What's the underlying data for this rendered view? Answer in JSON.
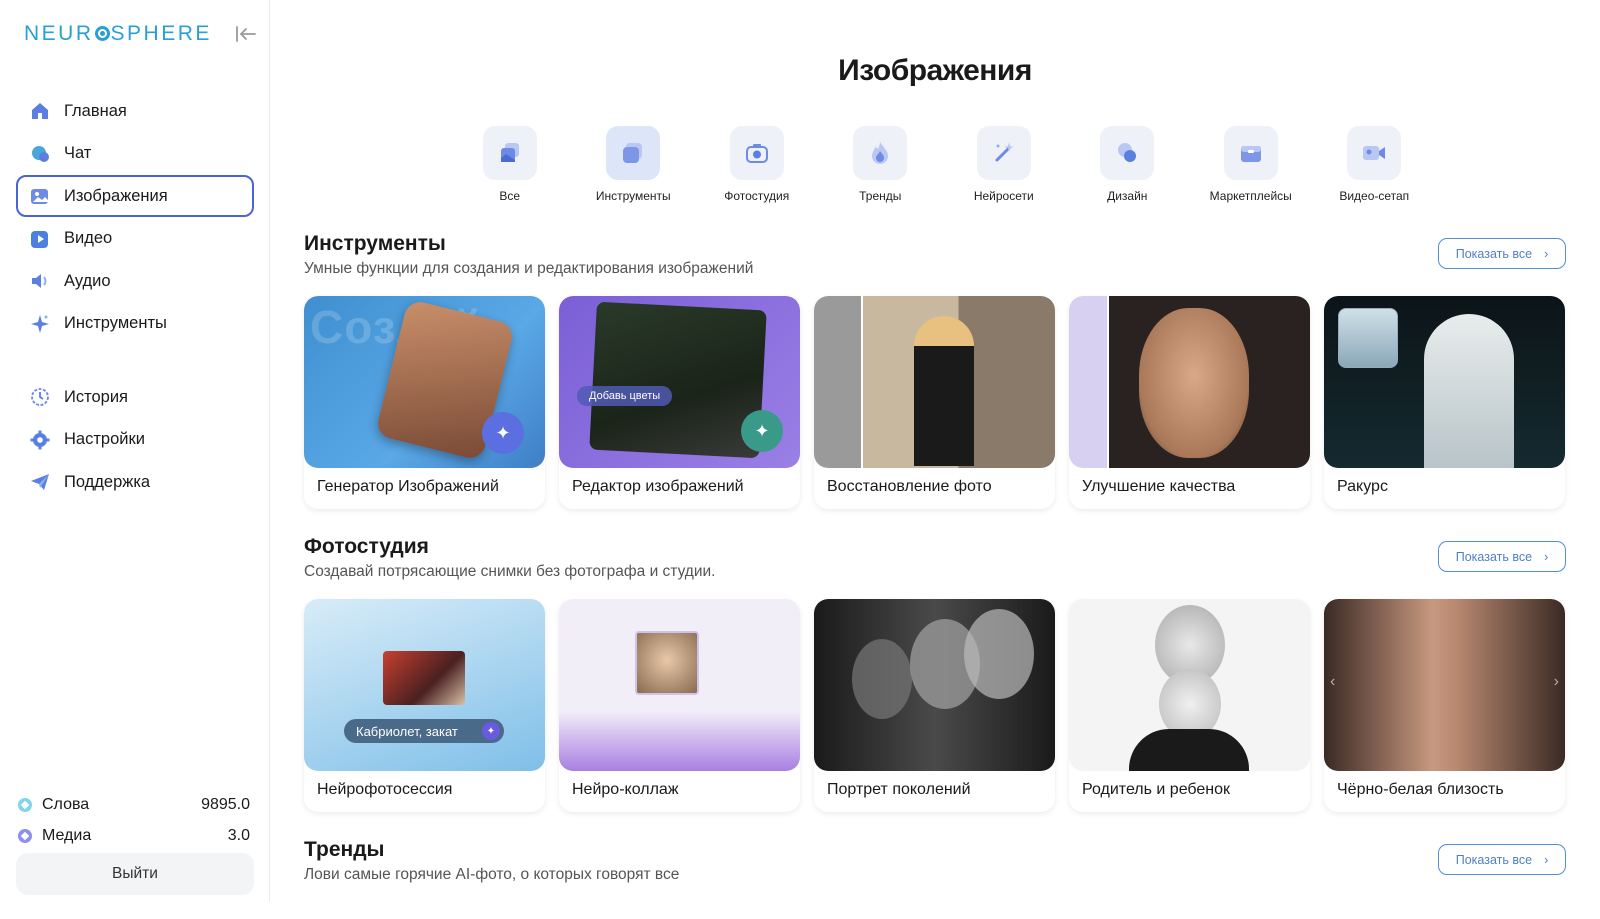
{
  "app": {
    "logo_text": "NEUROSPHERE"
  },
  "sidebar": {
    "main_items": [
      {
        "label": "Главная",
        "icon": "home-icon"
      },
      {
        "label": "Чат",
        "icon": "chat-icon"
      },
      {
        "label": "Изображения",
        "icon": "image-icon",
        "active": true
      },
      {
        "label": "Видео",
        "icon": "video-icon"
      },
      {
        "label": "Аудио",
        "icon": "audio-icon"
      },
      {
        "label": "Инструменты",
        "icon": "sparkle-icon"
      }
    ],
    "secondary_items": [
      {
        "label": "История",
        "icon": "history-icon"
      },
      {
        "label": "Настройки",
        "icon": "gear-icon"
      },
      {
        "label": "Поддержка",
        "icon": "paper-plane-icon"
      }
    ],
    "balances": [
      {
        "label": "Слова",
        "value": "9895.0",
        "color": "#7fd6e6"
      },
      {
        "label": "Медиа",
        "value": "3.0",
        "color": "#8f8ff0"
      }
    ],
    "logout_label": "Выйти"
  },
  "main": {
    "title": "Изображения",
    "categories": [
      {
        "label": "Все",
        "icon": "stack-icon"
      },
      {
        "label": "Инструменты",
        "icon": "layers-icon"
      },
      {
        "label": "Фотостудия",
        "icon": "camera-icon"
      },
      {
        "label": "Тренды",
        "icon": "flame-icon"
      },
      {
        "label": "Нейросети",
        "icon": "magic-wand-icon"
      },
      {
        "label": "Дизайн",
        "icon": "shapes-icon"
      },
      {
        "label": "Маркетплейсы",
        "icon": "box-icon"
      },
      {
        "label": "Видео-сетап",
        "icon": "video-camera-icon"
      }
    ],
    "show_all_label": "Показать все",
    "sections": [
      {
        "title": "Инструменты",
        "subtitle": "Умные функции для создания и редактирования изображений",
        "cards": [
          {
            "caption": "Генератор Изображений",
            "overlay": "Создай"
          },
          {
            "caption": "Редактор изображений",
            "overlay": "Добавь цветы"
          },
          {
            "caption": "Восстановление фото"
          },
          {
            "caption": "Улучшение качества"
          },
          {
            "caption": "Ракурс"
          }
        ]
      },
      {
        "title": "Фотостудия",
        "subtitle": "Создавай потрясающие снимки без фотографа и студии.",
        "cards": [
          {
            "caption": "Нейрофотосессия",
            "overlay": "Кабриолет, закат"
          },
          {
            "caption": "Нейро-коллаж"
          },
          {
            "caption": "Портрет поколений"
          },
          {
            "caption": "Родитель и ребенок"
          },
          {
            "caption": "Чёрно-белая близость"
          }
        ]
      },
      {
        "title": "Тренды",
        "subtitle": "Лови самые горячие AI-фото, о которых говорят все"
      }
    ]
  }
}
